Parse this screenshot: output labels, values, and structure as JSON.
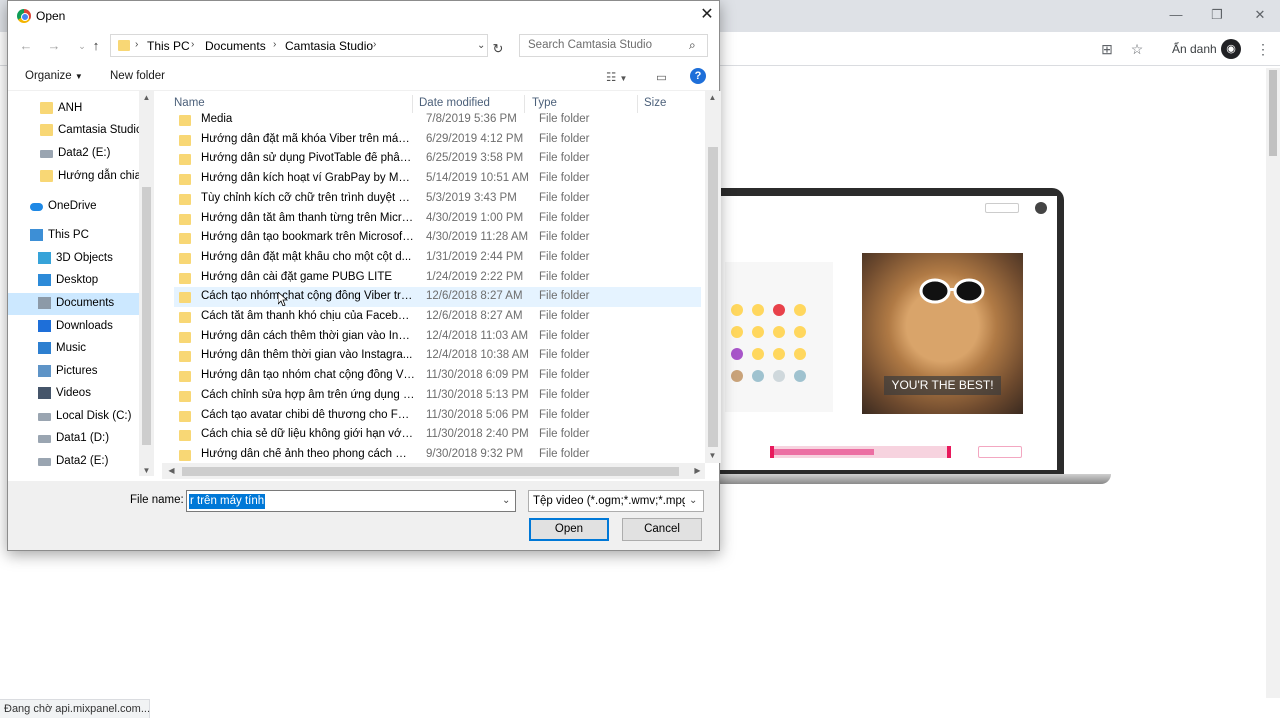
{
  "browser": {
    "incognito_label": "Ẩn danh",
    "status_text": "Đang chờ api.mixpanel.com..."
  },
  "background_page": {
    "caption": "YOU'R THE BEST!"
  },
  "dialog": {
    "title": "Open",
    "breadcrumb": [
      "This PC",
      "Documents",
      "Camtasia Studio"
    ],
    "search_placeholder": "Search Camtasia Studio",
    "organize_label": "Organize",
    "new_folder_label": "New folder",
    "nav_items": [
      {
        "label": "ANH",
        "icon": "folder-icon"
      },
      {
        "label": "Camtasia Studio",
        "icon": "folder-icon"
      },
      {
        "label": "Data2 (E:)",
        "icon": "drive-icon"
      },
      {
        "label": "Hướng dẫn chia",
        "icon": "folder-icon"
      },
      {
        "label": "OneDrive",
        "icon": "cloud-icon"
      },
      {
        "label": "This PC",
        "icon": "computer-icon"
      },
      {
        "label": "3D Objects",
        "icon": "cube-icon"
      },
      {
        "label": "Desktop",
        "icon": "desktop-icon"
      },
      {
        "label": "Documents",
        "icon": "documents-icon",
        "selected": true
      },
      {
        "label": "Downloads",
        "icon": "download-icon"
      },
      {
        "label": "Music",
        "icon": "music-icon"
      },
      {
        "label": "Pictures",
        "icon": "pictures-icon"
      },
      {
        "label": "Videos",
        "icon": "videos-icon"
      },
      {
        "label": "Local Disk (C:)",
        "icon": "drive-icon"
      },
      {
        "label": "Data1 (D:)",
        "icon": "drive-icon"
      },
      {
        "label": "Data2 (E:)",
        "icon": "drive-icon"
      }
    ],
    "columns": [
      "Name",
      "Date modified",
      "Type",
      "Size"
    ],
    "files": [
      {
        "name": "Media",
        "date": "7/8/2019 5:36 PM",
        "type": "File folder"
      },
      {
        "name": "Hướng dẫn đặt mã khóa Viber trên máy t...",
        "date": "6/29/2019 4:12 PM",
        "type": "File folder"
      },
      {
        "name": "Hướng dẫn sử dụng PivotTable để phân t...",
        "date": "6/25/2019 3:58 PM",
        "type": "File folder"
      },
      {
        "name": "Hướng dẫn kích hoạt ví GrabPay by Moca",
        "date": "5/14/2019 10:51 AM",
        "type": "File folder"
      },
      {
        "name": "Tùy chỉnh kích cỡ chữ trên trình duyệt M...",
        "date": "5/3/2019 3:43 PM",
        "type": "File folder"
      },
      {
        "name": "Hướng dẫn tắt âm thanh từng trên Micro...",
        "date": "4/30/2019 1:00 PM",
        "type": "File folder"
      },
      {
        "name": "Hướng dẫn tạo bookmark trên Microsoft...",
        "date": "4/30/2019 11:28 AM",
        "type": "File folder"
      },
      {
        "name": "Hướng dẫn đặt mật khẩu cho một cột d...",
        "date": "1/31/2019 2:44 PM",
        "type": "File folder"
      },
      {
        "name": "Hướng dẫn cài đặt game PUBG LITE",
        "date": "1/24/2019 2:22 PM",
        "type": "File folder"
      },
      {
        "name": "Cách tạo nhóm chat cộng đồng Viber trê...",
        "date": "12/6/2018 8:27 AM",
        "type": "File folder",
        "hover": true
      },
      {
        "name": "Cách tắt âm thanh khó chịu của Faceboo...",
        "date": "12/6/2018 8:27 AM",
        "type": "File folder"
      },
      {
        "name": "Hướng dẫn cách thêm thời gian vào Inst...",
        "date": "12/4/2018 11:03 AM",
        "type": "File folder"
      },
      {
        "name": "Hướng dẫn thêm thời gian vào Instagra...",
        "date": "12/4/2018 10:38 AM",
        "type": "File folder"
      },
      {
        "name": "Hướng dẫn tạo nhóm chat cộng đồng Vi...",
        "date": "11/30/2018 6:09 PM",
        "type": "File folder"
      },
      {
        "name": "Cách chỉnh sửa hợp âm trên ứng dụng H...",
        "date": "11/30/2018 5:13 PM",
        "type": "File folder"
      },
      {
        "name": "Cách tạo avatar chibi dễ thương cho Fac...",
        "date": "11/30/2018 5:06 PM",
        "type": "File folder"
      },
      {
        "name": "Cách chia sẻ dữ liệu không giới hạn với T...",
        "date": "11/30/2018 2:40 PM",
        "type": "File folder"
      },
      {
        "name": "Hướng dẫn chế ảnh theo phong cách Di...",
        "date": "9/30/2018 9:32 PM",
        "type": "File folder"
      }
    ],
    "file_name_label": "File name:",
    "file_name_value": "r trên máy tính",
    "file_type_value": "Tệp video (*.ogm;*.wmv;*.mpg",
    "open_label": "Open",
    "cancel_label": "Cancel"
  }
}
